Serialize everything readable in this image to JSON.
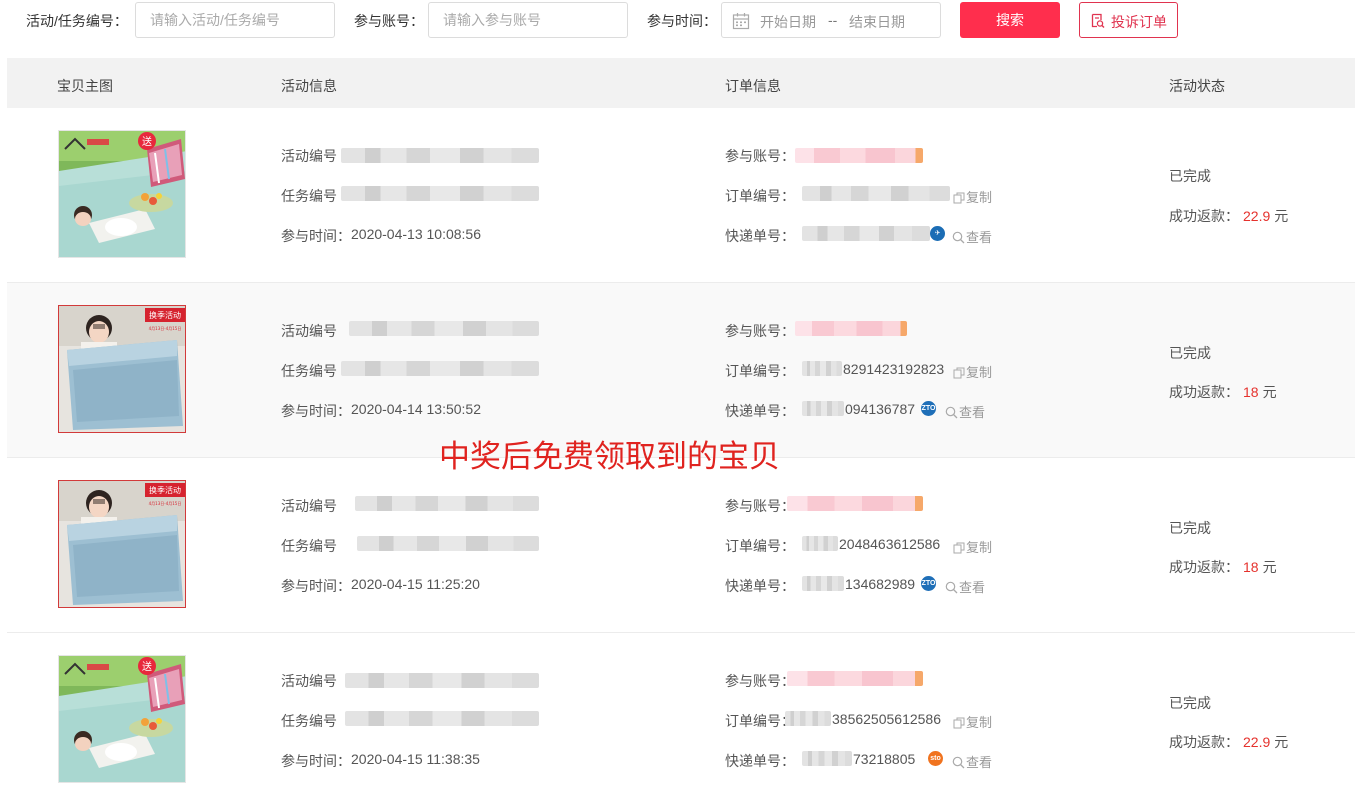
{
  "filter": {
    "activity_label": "活动/任务编号：",
    "activity_placeholder": "请输入活动/任务编号",
    "account_label": "参与账号：",
    "account_placeholder": "请输入参与账号",
    "time_label": "参与时间：",
    "date_start_placeholder": "开始日期",
    "date_sep": "--",
    "date_end_placeholder": "结束日期",
    "search_button": "搜索",
    "complain_button": "投诉订单"
  },
  "table": {
    "headers": [
      "宝贝主图",
      "活动信息",
      "订单信息",
      "活动状态"
    ],
    "labels": {
      "activity_no": "活动编号",
      "task_no": "任务编号",
      "join_time": "参与时间：",
      "account": "参与账号：",
      "order_no": "订单编号：",
      "tracking_no": "快递单号：",
      "copy": "复制",
      "view": "查看",
      "refund_prefix": "成功返款：",
      "currency": "元"
    },
    "rows": [
      {
        "product": "camping-mat",
        "join_time": "2020-04-13 10:08:56",
        "order_no": "",
        "tracking_no": "",
        "courier": "express-icon",
        "status": "已完成",
        "refund": "22.9"
      },
      {
        "product": "storage-box",
        "join_time": "2020-04-14 13:50:52",
        "order_no": "8291423192823",
        "tracking_no": "094136787",
        "courier": "zto-icon",
        "status": "已完成",
        "refund": "18"
      },
      {
        "product": "storage-box",
        "join_time": "2020-04-15 11:25:20",
        "order_no": "2048463612586",
        "tracking_no": "134682989",
        "courier": "zto-icon",
        "status": "已完成",
        "refund": "18"
      },
      {
        "product": "camping-mat",
        "join_time": "2020-04-15 11:38:35",
        "order_no": "38562505612586",
        "tracking_no": "73218805",
        "courier": "sto-icon",
        "status": "已完成",
        "refund": "22.9"
      }
    ]
  },
  "annotation": "中奖后免费领取到的宝贝",
  "colors": {
    "accent": "#ff2e4d",
    "refund": "#e5322d",
    "annotation": "#e0231f"
  },
  "images": {
    "mat_badge": "送",
    "box_badge": "换季活动",
    "box_badge_dates": "4月13日-4月15日"
  }
}
